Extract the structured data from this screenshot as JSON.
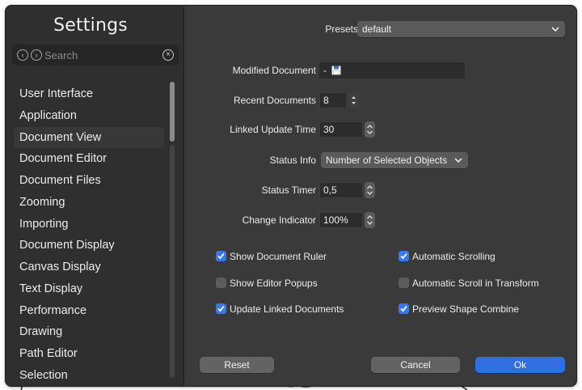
{
  "sidebar": {
    "title": "Settings",
    "search_placeholder": "Search",
    "items": [
      "User Interface",
      "Application",
      "Document View",
      "Document Editor",
      "Document Files",
      "Zooming",
      "Importing",
      "Document Display",
      "Canvas Display",
      "Text Display",
      "Performance",
      "Drawing",
      "Path Editor",
      "Selection"
    ],
    "selected": "Document View"
  },
  "settings": {
    "presets_label": "Presets",
    "presets_value": "default",
    "modified_document_label": "Modified Document",
    "modified_document_value": "-",
    "recent_documents_label": "Recent Documents",
    "recent_documents_value": "8",
    "linked_update_time_label": "Linked Update Time",
    "linked_update_time_value": "30",
    "status_info_label": "Status Info",
    "status_info_value": "Number of Selected Objects",
    "status_timer_label": "Status Timer",
    "status_timer_value": "0,5",
    "change_indicator_label": "Change Indicator",
    "change_indicator_value": "100%"
  },
  "checkboxes": [
    {
      "label": "Show Document Ruler",
      "checked": true
    },
    {
      "label": "Automatic Scrolling",
      "checked": true
    },
    {
      "label": "Show Editor Popups",
      "checked": false
    },
    {
      "label": "Automatic Scroll in Transform",
      "checked": false
    },
    {
      "label": "Update Linked Documents",
      "checked": true
    },
    {
      "label": "Preview Shape Combine",
      "checked": true
    }
  ],
  "buttons": {
    "reset": "Reset",
    "cancel": "Cancel",
    "ok": "Ok"
  },
  "colors": {
    "window_bg": "#3a3a3a",
    "sidebar_bg": "#2f2f2f",
    "accent": "#2f6fe0",
    "checkbox_on": "#3478f6"
  },
  "icons": {
    "modified_document_icon": "floppy-disk-icon"
  }
}
